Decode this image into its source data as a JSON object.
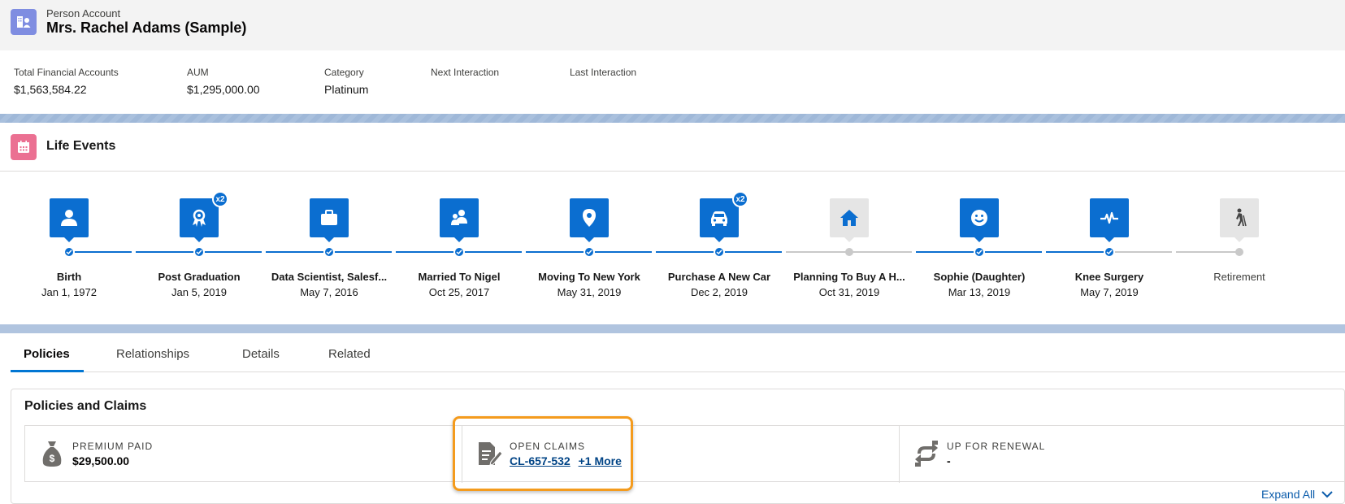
{
  "header": {
    "record_type": "Person Account",
    "record_name": "Mrs. Rachel Adams (Sample)"
  },
  "highlights": [
    {
      "label": "Total Financial Accounts",
      "value": "$1,563,584.22"
    },
    {
      "label": "AUM",
      "value": "$1,295,000.00"
    },
    {
      "label": "Category",
      "value": "Platinum"
    },
    {
      "label": "Next Interaction",
      "value": ""
    },
    {
      "label": "Last Interaction",
      "value": ""
    }
  ],
  "life_events": {
    "title": "Life Events",
    "events": [
      {
        "name": "Birth",
        "date": "Jan 1, 1972",
        "icon": "person-icon",
        "badge": ""
      },
      {
        "name": "Post Graduation",
        "date": "Jan 5, 2019",
        "icon": "award-icon",
        "badge": "x2"
      },
      {
        "name": "Data Scientist, Salesf...",
        "date": "May 7, 2016",
        "icon": "briefcase-icon",
        "badge": ""
      },
      {
        "name": "Married To Nigel",
        "date": "Oct 25, 2017",
        "icon": "couple-icon",
        "badge": ""
      },
      {
        "name": "Moving To New York",
        "date": "May 31, 2019",
        "icon": "location-pin-icon",
        "badge": ""
      },
      {
        "name": "Purchase A New Car",
        "date": "Dec 2, 2019",
        "icon": "car-icon",
        "badge": "x2"
      },
      {
        "name": "Planning To Buy A H...",
        "date": "Oct 31, 2019",
        "icon": "home-icon",
        "badge": ""
      },
      {
        "name": "Sophie (Daughter)",
        "date": "Mar 13, 2019",
        "icon": "smiley-icon",
        "badge": ""
      },
      {
        "name": "Knee Surgery",
        "date": "May 7, 2019",
        "icon": "pulse-icon",
        "badge": ""
      },
      {
        "name": "Retirement",
        "date": "",
        "icon": "walker-icon",
        "badge": ""
      }
    ]
  },
  "tabs": [
    "Policies",
    "Relationships",
    "Details",
    "Related"
  ],
  "policies_card": {
    "title": "Policies and Claims",
    "premium_label": "PREMIUM PAID",
    "premium_value": "$29,500.00",
    "claims_label": "OPEN CLAIMS",
    "claims_link": "CL-657-532",
    "claims_more": "+1 More",
    "renewal_label": "UP FOR RENEWAL",
    "renewal_value": "-"
  },
  "expand_all": "Expand All",
  "colors": {
    "brand_blue": "#0b6ed0",
    "highlight_orange": "#f49b1d",
    "account_icon": "#7f8de1",
    "life_icon": "#eb7092"
  }
}
